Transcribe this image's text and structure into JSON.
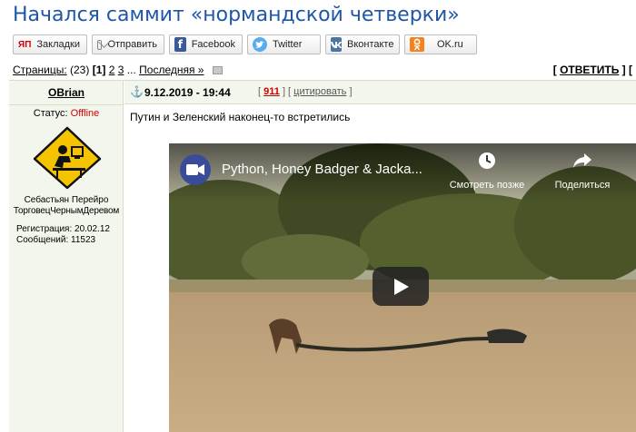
{
  "page": {
    "title": "Начался саммит «нормандской четверки»"
  },
  "share": {
    "buttons": [
      {
        "label": "Закладки",
        "icon": "yandex-icon"
      },
      {
        "label": "Отправить",
        "icon": "mail-icon"
      },
      {
        "label": "Facebook",
        "icon": "facebook-icon"
      },
      {
        "label": "Twitter",
        "icon": "twitter-icon"
      },
      {
        "label": "Вконтакте",
        "icon": "vk-icon"
      },
      {
        "label": "OK.ru",
        "icon": "odnoklassniki-icon"
      }
    ],
    "yandex_glyph": "ЯП",
    "fb_glyph": "f",
    "ok_glyph": "ок"
  },
  "pagination": {
    "label": "Страницы:",
    "count": "(23)",
    "current": "[1]",
    "pages": [
      "2",
      "3"
    ],
    "ellipsis": "...",
    "last_label": "Последняя »",
    "reply_open": "[",
    "reply_label": "ОТВЕТИТЬ",
    "reply_close": "] ["
  },
  "post": {
    "author": "OBrian",
    "status_label": "Статус:",
    "status_value": "Offline",
    "real_name": "Себастьян Перейро",
    "user_title": "ТорговецЧернымДеревом",
    "registration": "Регистрация: 20.02.12",
    "messages": "Сообщений: 11523",
    "datetime": "9.12.2019 - 19:44",
    "score_open": "[",
    "score": "911",
    "score_close": "] [",
    "quote_label": "цитировать",
    "quote_close": "]",
    "text": "Путин и Зеленский наконец-то встретились"
  },
  "video": {
    "title": "Python, Honey Badger & Jacka...",
    "watch_later_label": "Смотреть позже",
    "share_label": "Поделиться"
  },
  "colors": {
    "title": "#1f57a8",
    "sidebar_bg": "#f2f6ec",
    "offline": "#cc0000",
    "score": "#cc0000",
    "anchor": "#3a7db0"
  }
}
